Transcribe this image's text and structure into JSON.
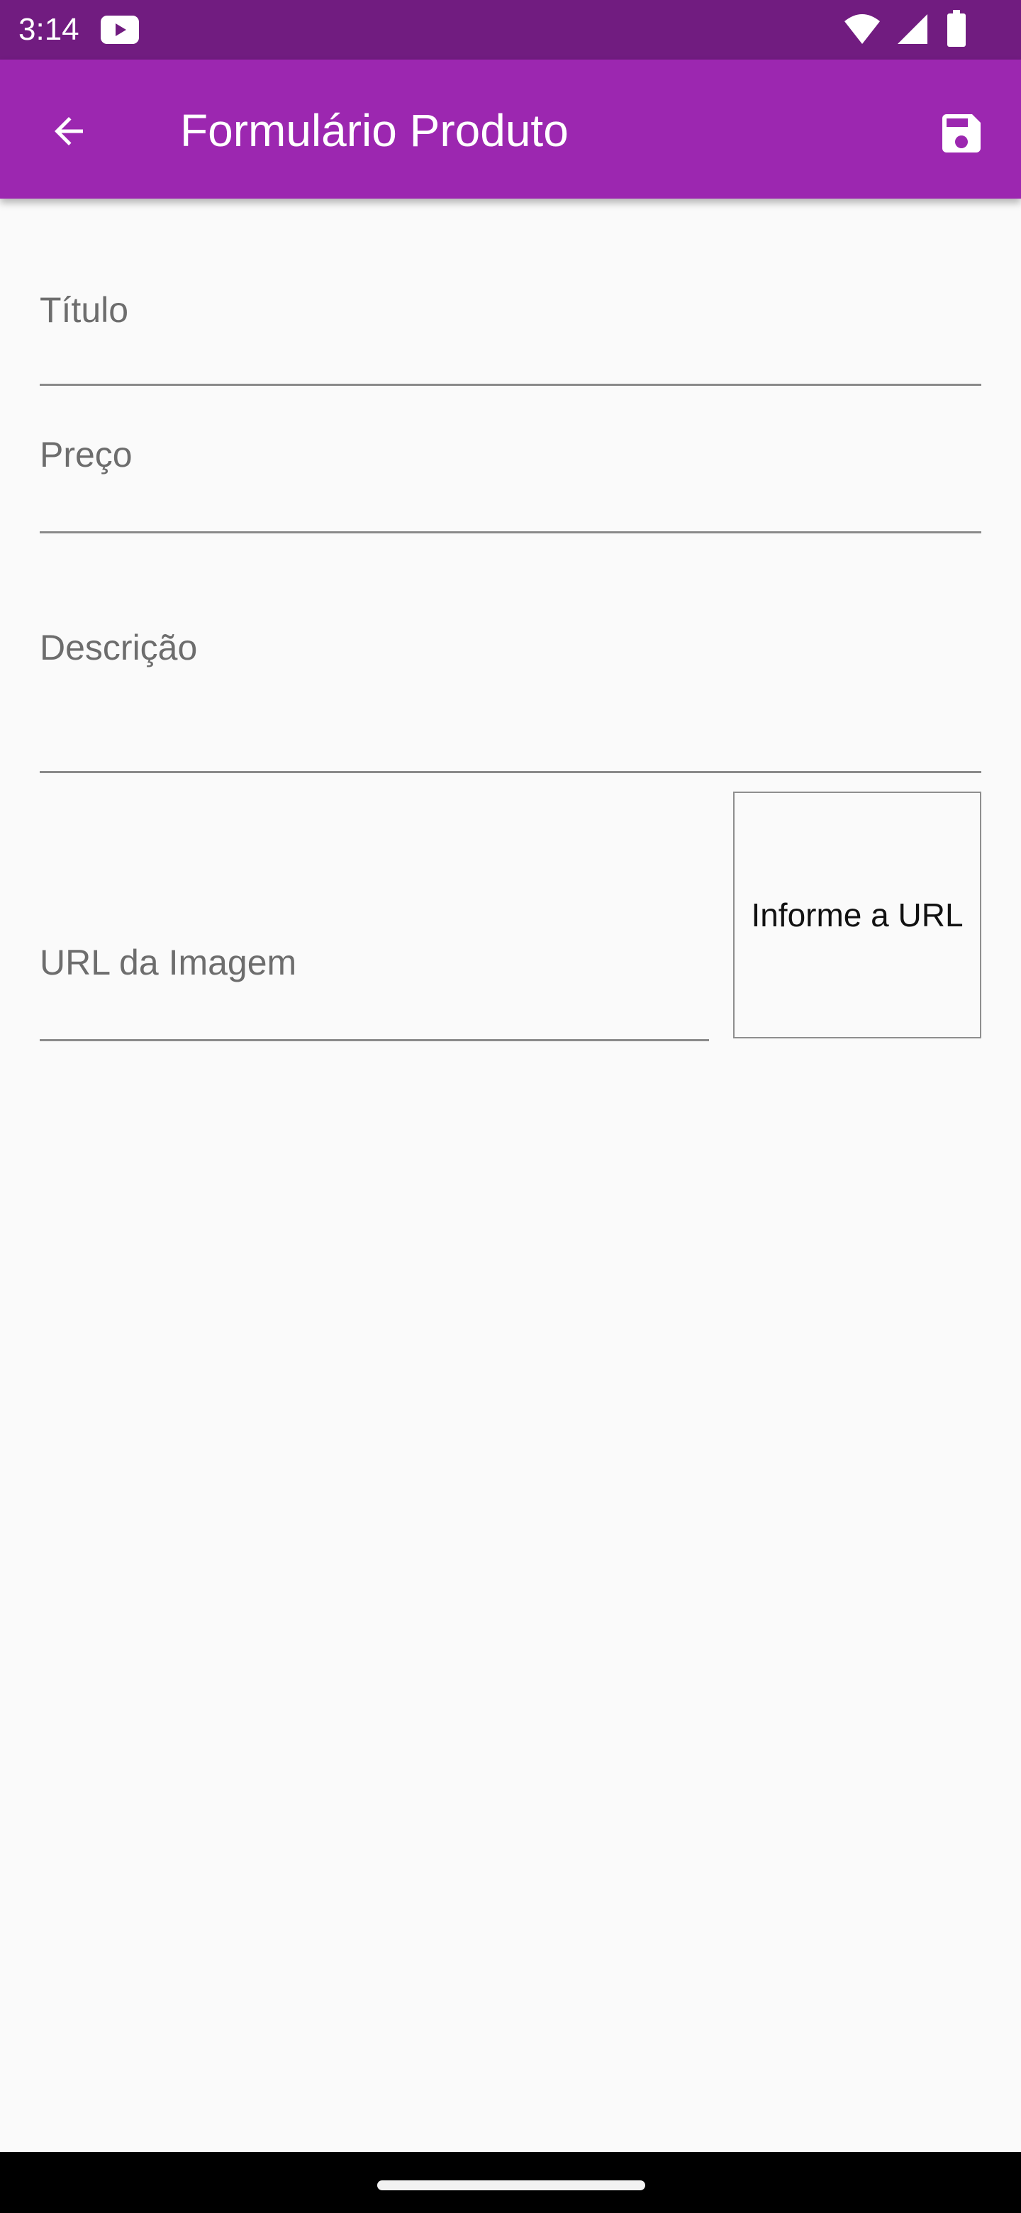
{
  "status_bar": {
    "time": "3:14",
    "icons": [
      "youtube-icon",
      "wifi-icon",
      "signal-icon",
      "battery-icon"
    ],
    "color": "#711c80"
  },
  "app_bar": {
    "title": "Formulário Produto",
    "back_icon": "arrow-back-icon",
    "save_icon": "save-floppy-icon",
    "color": "#9c27b0"
  },
  "form": {
    "titulo": {
      "label": "Título",
      "value": ""
    },
    "preco": {
      "label": "Preço",
      "value": ""
    },
    "descricao": {
      "label": "Descrição",
      "value": ""
    },
    "url_imagem": {
      "label": "URL da Imagem",
      "value": ""
    },
    "preview_text": "Informe a URL"
  },
  "nav_bar": {
    "handle_icon": "home-gesture-pill"
  }
}
